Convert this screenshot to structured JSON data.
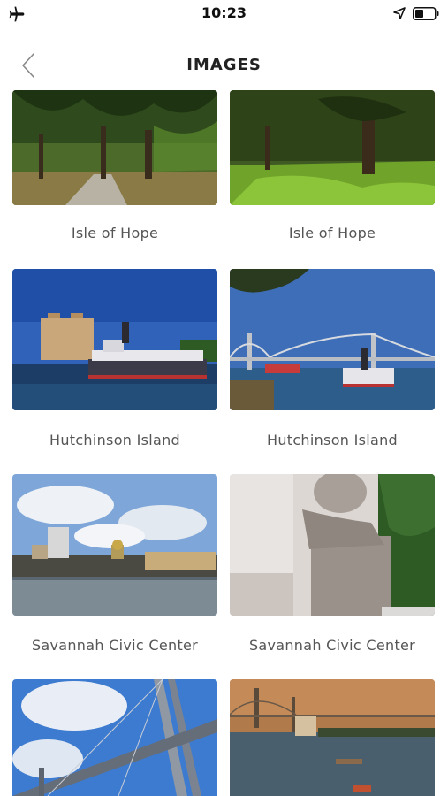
{
  "status_bar": {
    "time": "10:23"
  },
  "navbar": {
    "title": "IMAGES"
  },
  "images": [
    {
      "caption": "Isle of Hope"
    },
    {
      "caption": "Isle of Hope"
    },
    {
      "caption": "Hutchinson Island"
    },
    {
      "caption": "Hutchinson Island"
    },
    {
      "caption": "Savannah Civic Center"
    },
    {
      "caption": "Savannah Civic Center"
    }
  ]
}
